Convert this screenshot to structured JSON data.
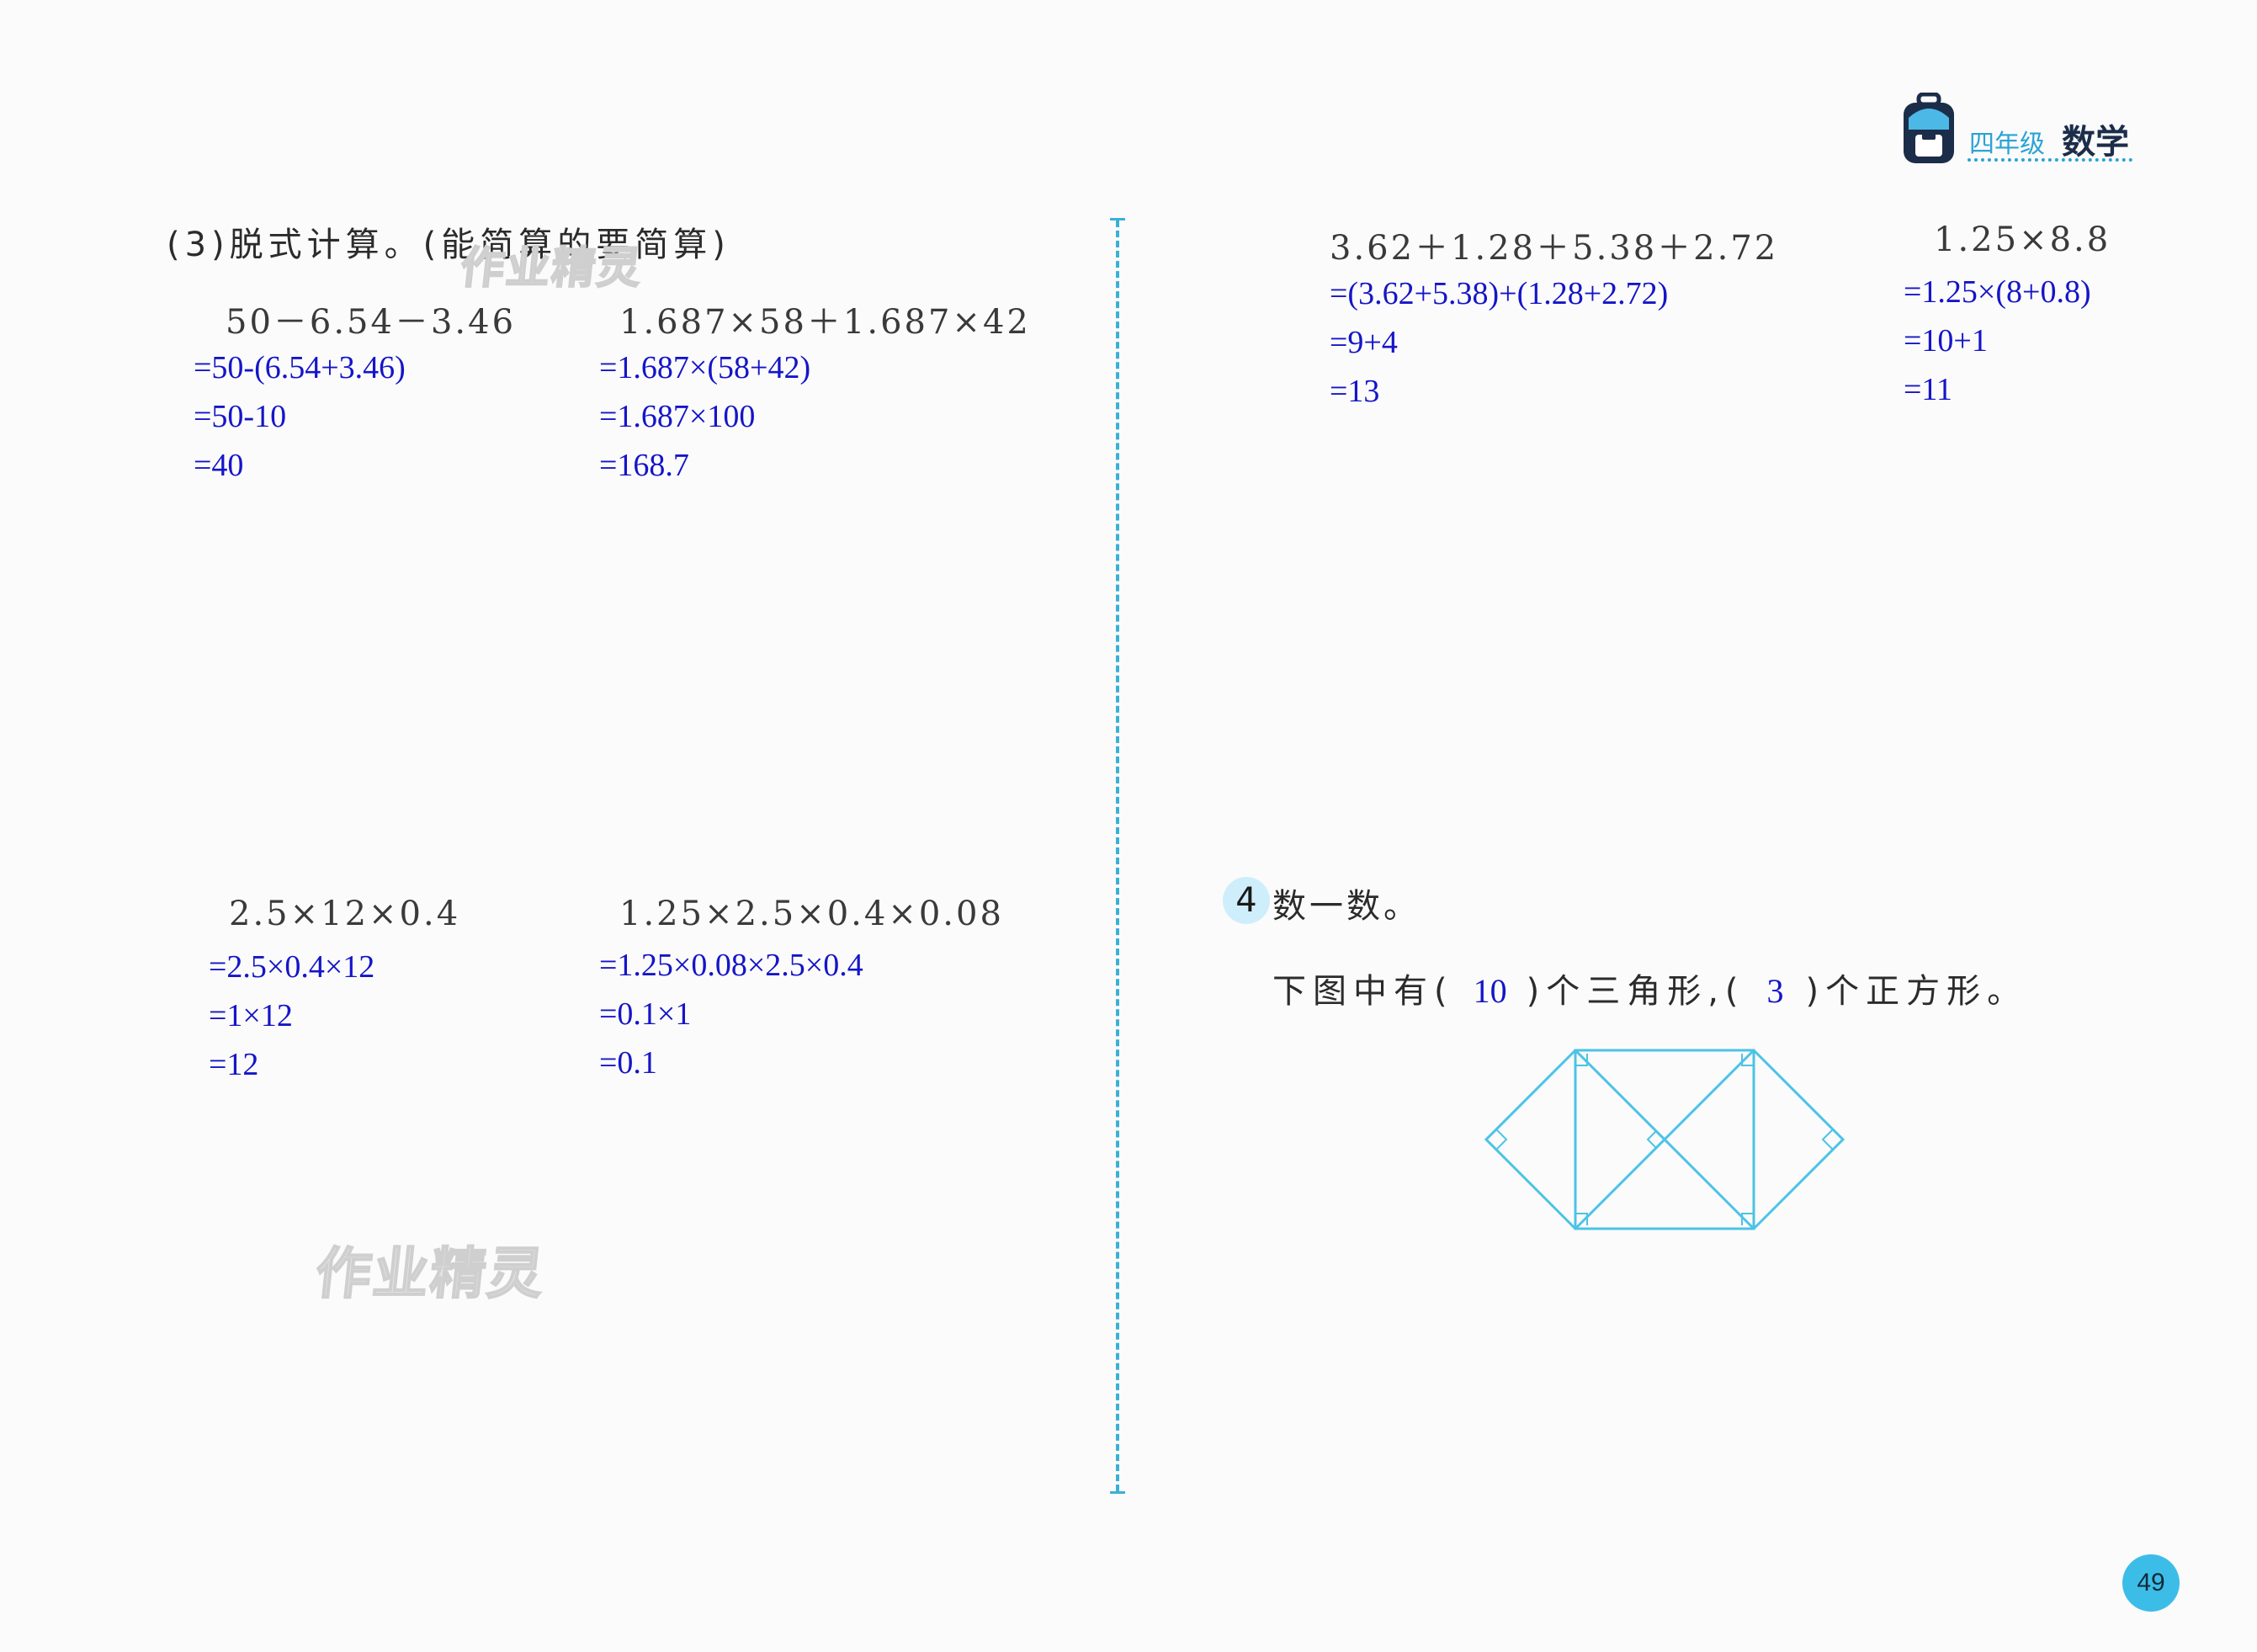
{
  "header": {
    "grade": "四年级",
    "subject": "数学"
  },
  "section3": {
    "title": "(3)脱式计算。(能简算的要简算)"
  },
  "problems": [
    {
      "question": "50－6.54－3.46",
      "steps": [
        "=50-(6.54+3.46)",
        "=50-10",
        "=40"
      ]
    },
    {
      "question": "1.687×58＋1.687×42",
      "steps": [
        "=1.687×(58+42)",
        "=1.687×100",
        "=168.7"
      ]
    },
    {
      "question": "2.5×12×0.4",
      "steps": [
        "=2.5×0.4×12",
        "=1×12",
        "=12"
      ]
    },
    {
      "question": "1.25×2.5×0.4×0.08",
      "steps": [
        "=1.25×0.08×2.5×0.4",
        "=0.1×1",
        "=0.1"
      ]
    },
    {
      "question": "3.62＋1.28＋5.38＋2.72",
      "steps": [
        "=(3.62+5.38)+(1.28+2.72)",
        "=9+4",
        "=13"
      ]
    },
    {
      "question": "1.25×8.8",
      "steps": [
        "=1.25×(8+0.8)",
        "=10+1",
        "=11"
      ]
    }
  ],
  "section4": {
    "number": "4",
    "title": "数一数。",
    "sentence": {
      "part1": "下图中有(",
      "answer1": "10",
      "part2": ")个三角形,(",
      "answer2": "3",
      "part3": ")个正方形。"
    }
  },
  "watermark": "作业精灵",
  "page_number": "49",
  "colors": {
    "handwriting": "#1515c8",
    "accent": "#3bb0d6",
    "figure_line": "#4cc3e6"
  }
}
